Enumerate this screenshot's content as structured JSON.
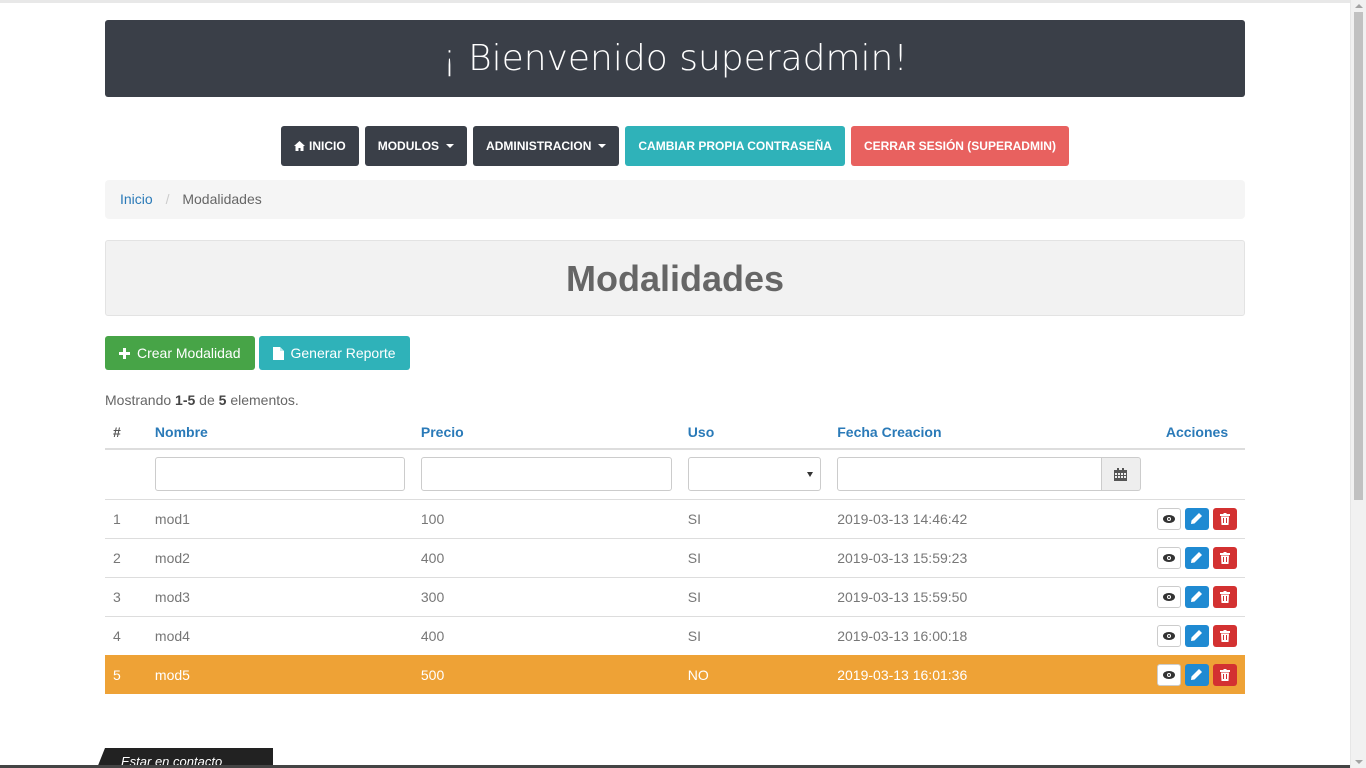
{
  "header": {
    "title": "¡ Bienvenido superadmin!"
  },
  "nav": {
    "items": [
      {
        "label": "INICIO"
      },
      {
        "label": "MODULOS"
      },
      {
        "label": "ADMINISTRACION"
      },
      {
        "label": "CAMBIAR PROPIA CONTRASEÑA"
      },
      {
        "label": "CERRAR SESIÓN (SUPERADMIN)"
      }
    ]
  },
  "breadcrumb": {
    "home": "Inicio",
    "current": "Modalidades"
  },
  "page": {
    "title": "Modalidades"
  },
  "actions": {
    "create": "Crear Modalidad",
    "report": "Generar Reporte"
  },
  "summary": {
    "prefix": "Mostrando",
    "range": "1-5",
    "of": "de",
    "total": "5",
    "suffix": "elementos."
  },
  "table": {
    "headers": [
      "#",
      "Nombre",
      "Precio",
      "Uso",
      "Fecha Creacion",
      "Acciones"
    ],
    "rows": [
      {
        "num": "1",
        "nombre": "mod1",
        "precio": "100",
        "uso": "SI",
        "fecha": "2019-03-13 14:46:42"
      },
      {
        "num": "2",
        "nombre": "mod2",
        "precio": "400",
        "uso": "SI",
        "fecha": "2019-03-13 15:59:23"
      },
      {
        "num": "3",
        "nombre": "mod3",
        "precio": "300",
        "uso": "SI",
        "fecha": "2019-03-13 15:59:50"
      },
      {
        "num": "4",
        "nombre": "mod4",
        "precio": "400",
        "uso": "SI",
        "fecha": "2019-03-13 16:00:18"
      },
      {
        "num": "5",
        "nombre": "mod5",
        "precio": "500",
        "uso": "NO",
        "fecha": "2019-03-13 16:01:36"
      }
    ]
  },
  "footer": {
    "tab": "Estar en contacto"
  },
  "colors": {
    "dark": "#3a3f48",
    "teal": "#2fb2b9",
    "red": "#e8615f",
    "green": "#47a447",
    "warning": "#eea236",
    "link": "#2a7ab8"
  },
  "icons": {
    "home": "home-icon",
    "plus": "plus-icon",
    "file": "file-icon",
    "calendar": "calendar-icon",
    "eye": "eye-icon",
    "pencil": "pencil-icon",
    "trash": "trash-icon"
  }
}
